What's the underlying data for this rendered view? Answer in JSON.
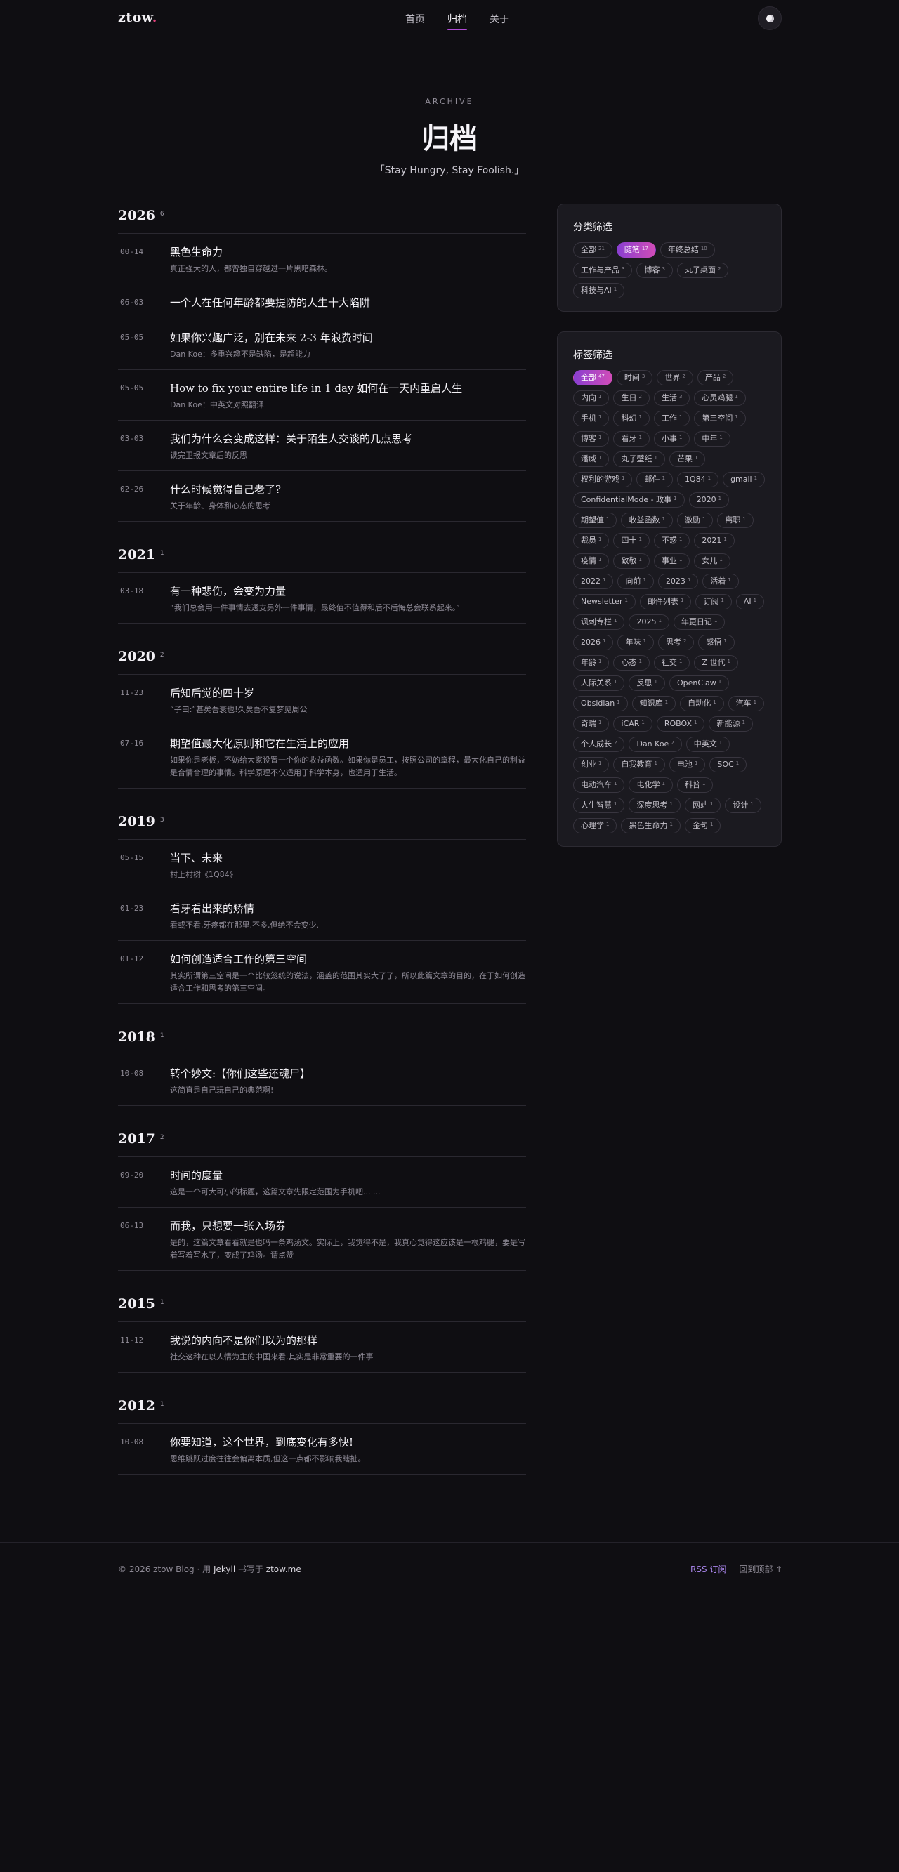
{
  "header": {
    "logo_text": "ztow",
    "logo_dot": ".",
    "nav": [
      {
        "label": "首页"
      },
      {
        "label": "归档"
      },
      {
        "label": "关于"
      }
    ],
    "theme_toggle_icon": "moon-icon"
  },
  "hero": {
    "kicker": "ARCHIVE",
    "title": "归档",
    "quote": "「Stay Hungry, Stay Foolish.」"
  },
  "archive": [
    {
      "year": "2026",
      "count": "6",
      "posts": [
        {
          "date": "00-14",
          "title": "黑色生命力",
          "summary": "真正强大的人，都曾独自穿越过一片黑暗森林。"
        },
        {
          "date": "06-03",
          "title": "一个人在任何年龄都要提防的人生十大陷阱",
          "summary": ""
        },
        {
          "date": "05-05",
          "title": "如果你兴趣广泛，别在未来 2-3 年浪费时间",
          "summary": "Dan Koe：多重兴趣不是缺陷，是超能力"
        },
        {
          "date": "05-05",
          "title": "How to fix your entire life in 1 day 如何在一天内重启人生",
          "summary": "Dan Koe：中英文对照翻译"
        },
        {
          "date": "03-03",
          "title": "我们为什么会变成这样：关于陌生人交谈的几点思考",
          "summary": "读完卫报文章后的反思"
        },
        {
          "date": "02-26",
          "title": "什么时候觉得自己老了?",
          "summary": "关于年龄、身体和心态的思考"
        }
      ]
    },
    {
      "year": "2021",
      "count": "1",
      "posts": [
        {
          "date": "03-18",
          "title": "有一种悲伤，会变为力量",
          "summary": "“我们总会用一件事情去透支另外一件事情，最终值不值得和后不后悔总会联系起来。”"
        }
      ]
    },
    {
      "year": "2020",
      "count": "2",
      "posts": [
        {
          "date": "11-23",
          "title": "后知后觉的四十岁",
          "summary": "“子曰:”甚矣吾衰也!久矣吾不复梦见周公"
        },
        {
          "date": "07-16",
          "title": "期望值最大化原则和它在生活上的应用",
          "summary": "如果你是老板，不妨给大家设置一个你的收益函数。如果你是员工，按照公司的章程，最大化自己的利益是合情合理的事情。科学原理不仅适用于科学本身，也适用于生活。"
        }
      ]
    },
    {
      "year": "2019",
      "count": "3",
      "posts": [
        {
          "date": "05-15",
          "title": "当下、未来",
          "summary": "村上村树《1Q84》"
        },
        {
          "date": "01-23",
          "title": "看牙看出来的矫情",
          "summary": "看或不看,牙疼都在那里,不多,但绝不会变少."
        },
        {
          "date": "01-12",
          "title": "如何创造适合工作的第三空间",
          "summary": "其实所谓第三空间是一个比较笼统的说法，涵盖的范围其实大了了，所以此篇文章的目的，在于如何创造适合工作和思考的第三空间。"
        }
      ]
    },
    {
      "year": "2018",
      "count": "1",
      "posts": [
        {
          "date": "10-08",
          "title": "转个妙文:【你们这些还魂尸】",
          "summary": "这简直是自己玩自己的典范啊!"
        }
      ]
    },
    {
      "year": "2017",
      "count": "2",
      "posts": [
        {
          "date": "09-20",
          "title": "时间的度量",
          "summary": "这是一个可大可小的标题，这篇文章先限定范围为手机吧... ..."
        },
        {
          "date": "06-13",
          "title": "而我，只想要一张入场券",
          "summary": "是的，这篇文章看看就是也吗一条鸡汤文。实际上，我觉得不是，我真心觉得这应该是一根鸡腿，要是写着写着写水了，变成了鸡汤。请点赞"
        }
      ]
    },
    {
      "year": "2015",
      "count": "1",
      "posts": [
        {
          "date": "11-12",
          "title": "我说的内向不是你们以为的那样",
          "summary": "社交这种在以人情为主的中国来看,其实是非常重要的一件事"
        }
      ]
    },
    {
      "year": "2012",
      "count": "1",
      "posts": [
        {
          "date": "10-08",
          "title": "你要知道，这个世界，到底变化有多快!",
          "summary": "思维跳跃过度往往会偏离本质,但这一点都不影响我瞎扯。"
        }
      ]
    }
  ],
  "category_filter": {
    "title": "分类筛选",
    "chips": [
      {
        "label": "全部",
        "count": "21",
        "active": false
      },
      {
        "label": "随笔",
        "count": "17",
        "active": true
      },
      {
        "label": "年终总结",
        "count": "10",
        "active": false
      },
      {
        "label": "工作与产品",
        "count": "3",
        "active": false
      },
      {
        "label": "博客",
        "count": "3",
        "active": false
      },
      {
        "label": "丸子桌面",
        "count": "2",
        "active": false
      },
      {
        "label": "科技与AI",
        "count": "1",
        "active": false
      }
    ]
  },
  "tag_filter": {
    "title": "标签筛选",
    "chips": [
      {
        "label": "全部",
        "count": "47",
        "active": true
      },
      {
        "label": "时间",
        "count": "3"
      },
      {
        "label": "世界",
        "count": "2"
      },
      {
        "label": "产品",
        "count": "2"
      },
      {
        "label": "内向",
        "count": "1"
      },
      {
        "label": "生日",
        "count": "2"
      },
      {
        "label": "生活",
        "count": "3"
      },
      {
        "label": "心灵鸡腿",
        "count": "1"
      },
      {
        "label": "手机",
        "count": "1"
      },
      {
        "label": "科幻",
        "count": "1"
      },
      {
        "label": "工作",
        "count": "1"
      },
      {
        "label": "第三空间",
        "count": "1"
      },
      {
        "label": "博客",
        "count": "1"
      },
      {
        "label": "看牙",
        "count": "1"
      },
      {
        "label": "小事",
        "count": "1"
      },
      {
        "label": "中年",
        "count": "1"
      },
      {
        "label": "潘威",
        "count": "1"
      },
      {
        "label": "丸子壁纸",
        "count": "1"
      },
      {
        "label": "芒果",
        "count": "1"
      },
      {
        "label": "权利的游戏",
        "count": "1"
      },
      {
        "label": "邮件",
        "count": "1"
      },
      {
        "label": "1Q84",
        "count": "1"
      },
      {
        "label": "gmail",
        "count": "1"
      },
      {
        "label": "ConfidentialMode - 政事",
        "count": "1"
      },
      {
        "label": "2020",
        "count": "1"
      },
      {
        "label": "期望值",
        "count": "1"
      },
      {
        "label": "收益函数",
        "count": "1"
      },
      {
        "label": "激励",
        "count": "1"
      },
      {
        "label": "离职",
        "count": "1"
      },
      {
        "label": "裁员",
        "count": "1"
      },
      {
        "label": "四十",
        "count": "1"
      },
      {
        "label": "不惑",
        "count": "1"
      },
      {
        "label": "2021",
        "count": "1"
      },
      {
        "label": "疫情",
        "count": "1"
      },
      {
        "label": "致敬",
        "count": "1"
      },
      {
        "label": "事业",
        "count": "1"
      },
      {
        "label": "女儿",
        "count": "1"
      },
      {
        "label": "2022",
        "count": "1"
      },
      {
        "label": "向前",
        "count": "1"
      },
      {
        "label": "2023",
        "count": "1"
      },
      {
        "label": "活着",
        "count": "1"
      },
      {
        "label": "Newsletter",
        "count": "1"
      },
      {
        "label": "邮件列表",
        "count": "1"
      },
      {
        "label": "订阅",
        "count": "1"
      },
      {
        "label": "AI",
        "count": "1"
      },
      {
        "label": "讽刺专栏",
        "count": "1"
      },
      {
        "label": "2025",
        "count": "1"
      },
      {
        "label": "年更日记",
        "count": "1"
      },
      {
        "label": "2026",
        "count": "1"
      },
      {
        "label": "年味",
        "count": "1"
      },
      {
        "label": "思考",
        "count": "2"
      },
      {
        "label": "感悟",
        "count": "1"
      },
      {
        "label": "年龄",
        "count": "1"
      },
      {
        "label": "心态",
        "count": "1"
      },
      {
        "label": "社交",
        "count": "1"
      },
      {
        "label": "Z 世代",
        "count": "1"
      },
      {
        "label": "人际关系",
        "count": "1"
      },
      {
        "label": "反思",
        "count": "1"
      },
      {
        "label": "OpenClaw",
        "count": "1"
      },
      {
        "label": "Obsidian",
        "count": "1"
      },
      {
        "label": "知识库",
        "count": "1"
      },
      {
        "label": "自动化",
        "count": "1"
      },
      {
        "label": "汽车",
        "count": "1"
      },
      {
        "label": "奇瑞",
        "count": "1"
      },
      {
        "label": "iCAR",
        "count": "1"
      },
      {
        "label": "ROBOX",
        "count": "1"
      },
      {
        "label": "新能源",
        "count": "1"
      },
      {
        "label": "个人成长",
        "count": "2"
      },
      {
        "label": "Dan Koe",
        "count": "2"
      },
      {
        "label": "中英文",
        "count": "1"
      },
      {
        "label": "创业",
        "count": "1"
      },
      {
        "label": "自我教育",
        "count": "1"
      },
      {
        "label": "电池",
        "count": "1"
      },
      {
        "label": "SOC",
        "count": "1"
      },
      {
        "label": "电动汽车",
        "count": "1"
      },
      {
        "label": "电化学",
        "count": "1"
      },
      {
        "label": "科普",
        "count": "1"
      },
      {
        "label": "人生智慧",
        "count": "1"
      },
      {
        "label": "深度思考",
        "count": "1"
      },
      {
        "label": "网站",
        "count": "1"
      },
      {
        "label": "设计",
        "count": "1"
      },
      {
        "label": "心理学",
        "count": "1"
      },
      {
        "label": "黑色生命力",
        "count": "1"
      },
      {
        "label": "金句",
        "count": "1"
      }
    ]
  },
  "footer": {
    "copyright": "© 2026 ztow Blog · 用 ",
    "engine": "Jekyll",
    "written_at": " 书写于 ",
    "domain": "ztow.me",
    "rss_label": "RSS 订阅",
    "top_label": "回到顶部 ↑"
  }
}
